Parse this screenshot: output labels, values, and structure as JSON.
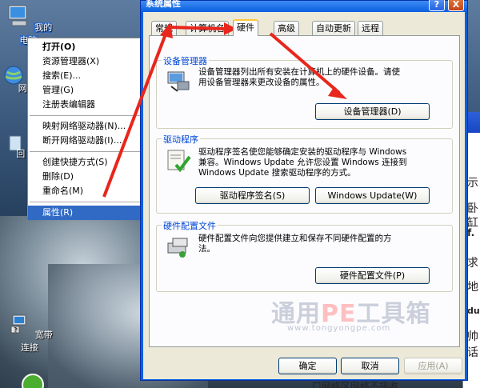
{
  "desktop": {
    "icons": [
      {
        "label": "我的电脑"
      },
      {
        "label": "网上"
      },
      {
        "label": "回"
      },
      {
        "label": "宽带连接"
      }
    ]
  },
  "context_menu": {
    "items": [
      {
        "label": "打开(O)",
        "bold": true
      },
      {
        "label": "资源管理器(X)"
      },
      {
        "label": "搜索(E)..."
      },
      {
        "label": "管理(G)"
      },
      {
        "label": "注册表编辑器"
      },
      {
        "label": "映射网络驱动器(N)..."
      },
      {
        "label": "断开网络驱动器(I)..."
      },
      {
        "label": "创建快捷方式(S)"
      },
      {
        "label": "删除(D)"
      },
      {
        "label": "重命名(M)"
      },
      {
        "label": "属性(R)",
        "active": true
      }
    ]
  },
  "dialog": {
    "title": "系统属性",
    "help": "?",
    "close": "X",
    "tabs": [
      "常规",
      "计算机名",
      "硬件",
      "高级",
      "自动更新",
      "远程"
    ],
    "active_tab": "硬件",
    "groups": {
      "device_manager": {
        "title": "设备管理器",
        "text1": "设备管理器列出所有安装在计算机上的硬件设备。请使",
        "text2": "用设备管理器来更改设备的属性。",
        "button": "设备管理器(D)"
      },
      "drivers": {
        "title": "驱动程序",
        "text1": "驱动程序签名使您能够确定安装的驱动程序与 Windows",
        "text2": "兼容。Windows Update 允许您设置 Windows 连接到",
        "text3": "Windows Update 搜索驱动程序的方式。",
        "button1": "驱动程序签名(S)",
        "button2": "Windows Update(W)"
      },
      "hw_profiles": {
        "title": "硬件配置文件",
        "text1": "硬件配置文件向您提供建立和保存不同硬件配置的方",
        "text2": "法。",
        "button": "硬件配置文件(P)"
      }
    },
    "buttons": {
      "ok": "确定",
      "cancel": "取消",
      "apply": "应用(A)"
    }
  },
  "watermark": {
    "title_a": "通用",
    "title_pe": "PE",
    "title_b": "工具箱",
    "url": "www.tongyongpe.com"
  },
  "bg_window": {
    "chars": [
      "示",
      "卧",
      "缸",
      "f.",
      "求",
      "地",
      "du",
      "帅",
      "话"
    ],
    "bottom": "口网络区网络不接收"
  },
  "colors": {
    "arrow": "#e8261c",
    "selection": "#316ac5",
    "group_title": "#0046d5"
  }
}
